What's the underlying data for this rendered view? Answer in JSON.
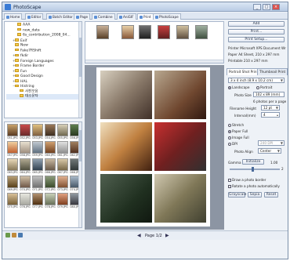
{
  "window": {
    "title": "PhotoScape",
    "minimize": "_",
    "maximize": "□",
    "close": "×"
  },
  "tabs": [
    {
      "label": "Home"
    },
    {
      "label": "Editor"
    },
    {
      "label": "Batch Editor"
    },
    {
      "label": "Page"
    },
    {
      "label": "Combine"
    },
    {
      "label": "AniGIF"
    },
    {
      "label": "Print"
    },
    {
      "label": "PhotoScape"
    }
  ],
  "tree": {
    "items": [
      "AAA",
      "new_data",
      "6s_contribution_2008_04...",
      "Exif",
      "New",
      "Fake7RShift",
      "fkdir",
      "Foreign Languages",
      "Frame Border",
      "Fun",
      "Good Design",
      "HAL",
      "Histring",
      "사진모음",
      "대소문자"
    ]
  },
  "thumbs": {
    "labels": [
      "051.JPG",
      "052.JPG",
      "053.JPG",
      "054.JPG",
      "055.JPG",
      "056.JPG",
      "057.JPG",
      "058.JPG",
      "059.JPG",
      "060.JPG",
      "061.JPG",
      "062.JPG",
      "063.JPG",
      "064.JPG",
      "065.JPG",
      "066.JPG",
      "067.JPG",
      "068.JPG",
      "069.JPG",
      "070.JPG",
      "071.JPG",
      "072.JPG",
      "073.JPG",
      "074.JPG",
      "075.JPG",
      "076.JPG",
      "077.JPG",
      "078.JPG",
      "079.JPG",
      "080.JPG"
    ]
  },
  "status": {
    "page": "Page 1/2"
  },
  "panel": {
    "add_label": "Add",
    "print_label": "Print...",
    "print_setup_label": "Print Setup...",
    "printer_line": "Printer  Microsoft XPS Document Wr",
    "paper_line": "Paper  A4 Sheet, 210 x 297 mm",
    "printable_line": "Printable  210 x 297 mm",
    "tab_portrait": "Portrait Shot Print",
    "tab_thumbnail": "Thumbnail Print",
    "size_select": "3 x 4 inch (8.9 x 10.2 cm)",
    "landscape": "Landscape",
    "portrait": "Portrait",
    "photo_size_label": "Photo Size",
    "photo_size_value": "102 x 89 (mm)",
    "per_page": "6 photos per a page",
    "filename_height_label": "Filename Height",
    "filename_height_value": "12 pt",
    "interval_label": "Interval(mm)",
    "interval_value": "4",
    "stretch": "Stretch",
    "paper_full": "Paper Full",
    "image_full": "Image Full",
    "dpi": "DPI",
    "dpi_value": "240 DPI",
    "photo_align_label": "Photo Align",
    "photo_align_value": "Center",
    "gamma_label": "Gamma",
    "gamma_btn": "Initialize",
    "gamma_value": "1.00",
    "gamma_range": "2",
    "draw_border": "Draw a photo border",
    "rotate_auto": "Rotate a photo automatically",
    "grayscale_btn": "Grayscale",
    "sepia_btn": "Sepia",
    "reset_btn": "Reset"
  }
}
